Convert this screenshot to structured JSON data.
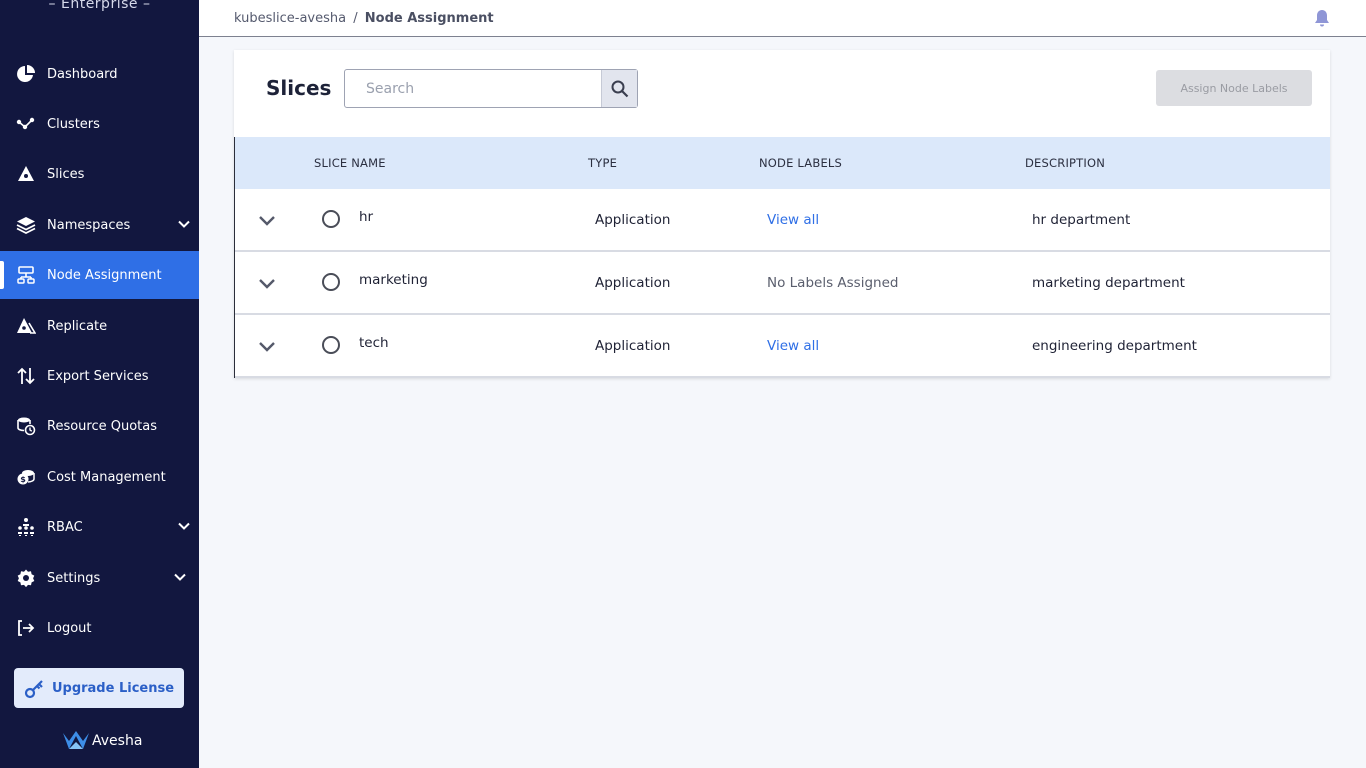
{
  "sidebar": {
    "brand": "– Enterprise –",
    "items": [
      {
        "label": "Dashboard",
        "icon": "pie-chart-icon"
      },
      {
        "label": "Clusters",
        "icon": "cluster-icon"
      },
      {
        "label": "Slices",
        "icon": "slices-icon"
      },
      {
        "label": "Namespaces",
        "icon": "layers-icon",
        "expandable": true
      },
      {
        "label": "Node Assignment",
        "icon": "node-assignment-icon",
        "active": true
      },
      {
        "label": "Replicate",
        "icon": "replicate-icon"
      },
      {
        "label": "Export Services",
        "icon": "arrows-up-down-icon"
      },
      {
        "label": "Resource Quotas",
        "icon": "resource-quota-icon"
      },
      {
        "label": "Cost Management",
        "icon": "cost-coins-icon"
      },
      {
        "label": "RBAC",
        "icon": "rbac-people-icon",
        "expandable": true
      },
      {
        "label": "Settings",
        "icon": "gear-icon",
        "expandable": true
      },
      {
        "label": "Logout",
        "icon": "logout-icon"
      }
    ],
    "upgrade_label": "Upgrade License",
    "logo_text": "Avesha"
  },
  "header": {
    "breadcrumb_root": "kubeslice-avesha",
    "breadcrumb_sep": "/",
    "breadcrumb_current": "Node Assignment"
  },
  "card": {
    "title": "Slices",
    "search_placeholder": "Search",
    "assign_label": "Assign Node Labels"
  },
  "table": {
    "columns": [
      "SLICE NAME",
      "TYPE",
      "NODE LABELS",
      "DESCRIPTION"
    ],
    "rows": [
      {
        "name": "hr",
        "type": "Application",
        "labels": "View all",
        "labels_kind": "link",
        "desc": "hr department"
      },
      {
        "name": "marketing",
        "type": "Application",
        "labels": "No Labels Assigned",
        "labels_kind": "muted",
        "desc": "marketing department"
      },
      {
        "name": "tech",
        "type": "Application",
        "labels": "View all",
        "labels_kind": "link",
        "desc": "engineering department"
      }
    ]
  },
  "colors": {
    "sidebar_bg": "#12173f",
    "accent": "#2f6fe6",
    "table_header_bg": "#dbe8fa"
  }
}
